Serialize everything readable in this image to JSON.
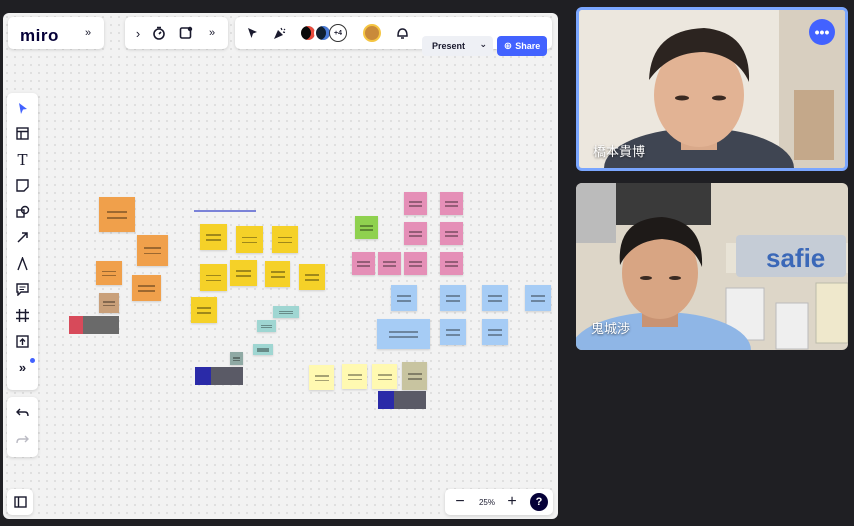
{
  "app": {
    "logo": "miro"
  },
  "toolbar": {
    "present_label": "Present",
    "share_label": "Share",
    "collaborators_extra": "+4"
  },
  "board": {
    "zoom_label": "25%",
    "help_label": "?"
  },
  "video": {
    "participants": [
      {
        "name": "橋本貴博"
      },
      {
        "name": "鬼城渉"
      }
    ],
    "logo_text": "safie"
  },
  "icons": {
    "chevrons": "chevrons-down-icon",
    "timer": "timer-icon",
    "frame": "frame-icon",
    "select": "cursor-icon",
    "reactions": "celebrate-icon",
    "notifications": "bell-icon",
    "globe": "globe-icon"
  },
  "colors": {
    "accent": "#4262ff",
    "orange_sticky": "#f0a04b",
    "yellow_sticky": "#f5d128",
    "blue_sticky": "#a6ccf5",
    "pink_sticky": "#e58fb7",
    "green_sticky": "#8fd14f",
    "teal_sticky": "#9fd6d2",
    "light_yellow_sticky": "#fff9b1"
  }
}
